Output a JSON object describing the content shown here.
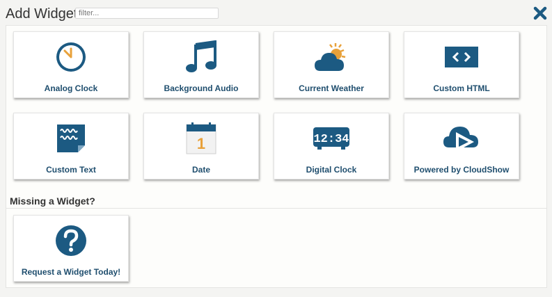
{
  "header": {
    "title": "Add Widget",
    "filter_placeholder": "filter...",
    "close_icon": "close-x-icon"
  },
  "colors": {
    "icon_blue": "#1c5a82",
    "label_blue": "#1f4e6e",
    "sun_orange": "#e8a13a"
  },
  "widgets": [
    {
      "label": "Analog Clock",
      "icon": "analog-clock-icon"
    },
    {
      "label": "Background Audio",
      "icon": "music-note-icon"
    },
    {
      "label": "Current Weather",
      "icon": "weather-cloud-sun-icon"
    },
    {
      "label": "Custom HTML",
      "icon": "code-brackets-icon"
    },
    {
      "label": "Custom Text",
      "icon": "text-document-icon"
    },
    {
      "label": "Date",
      "icon": "calendar-date-icon"
    },
    {
      "label": "Digital Clock",
      "icon": "digital-clock-icon"
    },
    {
      "label": "Powered by CloudShow",
      "icon": "cloudshow-logo-icon"
    }
  ],
  "missing": {
    "title": "Missing a Widget?",
    "request_label": "Request a Widget Today!",
    "request_icon": "question-circle-icon"
  },
  "calendar_day": "1",
  "digital_time": "12:34"
}
